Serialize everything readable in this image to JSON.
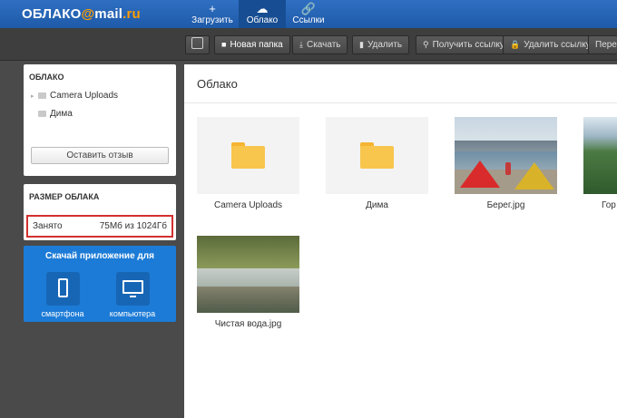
{
  "header": {
    "logo_main": "ОБЛАКО",
    "logo_at": "@",
    "logo_mail": "mail",
    "logo_ru": ".ru",
    "nav": [
      {
        "label": "Загрузить",
        "icon": "plus-icon"
      },
      {
        "label": "Облако",
        "icon": "cloud-icon"
      },
      {
        "label": "Ссылки",
        "icon": "link-icon"
      }
    ]
  },
  "toolbar": {
    "new_folder": "Новая папка",
    "download": "Скачать",
    "delete": "Удалить",
    "get_link": "Получить ссылку",
    "delete_link": "Удалить ссылку",
    "move": "Пере"
  },
  "sidebar": {
    "cloud_title": "ОБЛАКО",
    "folders": [
      "Camera Uploads",
      "Дима"
    ],
    "feedback_button": "Оставить отзыв",
    "size_title": "РАЗМЕР ОБЛАКА",
    "used_label": "Занято",
    "used_value": "75Мб из 1024Гб",
    "app_title": "Скачай приложение для",
    "app_phone": "смартфона",
    "app_pc": "компьютера"
  },
  "main": {
    "title": "Облако",
    "items": [
      {
        "name": "Camera Uploads",
        "type": "folder"
      },
      {
        "name": "Дима",
        "type": "folder"
      },
      {
        "name": "Берег.jpg",
        "type": "image"
      },
      {
        "name": "Гор",
        "type": "image"
      },
      {
        "name": "Чистая вода.jpg",
        "type": "image"
      }
    ]
  },
  "colors": {
    "header": "#1e5aa8",
    "toolbar": "#3e3e3e",
    "accent_orange": "#ff9e00",
    "app_panel": "#1c7bd6",
    "highlight_red": "#d32f2f",
    "folder_yellow": "#f8c54d"
  }
}
